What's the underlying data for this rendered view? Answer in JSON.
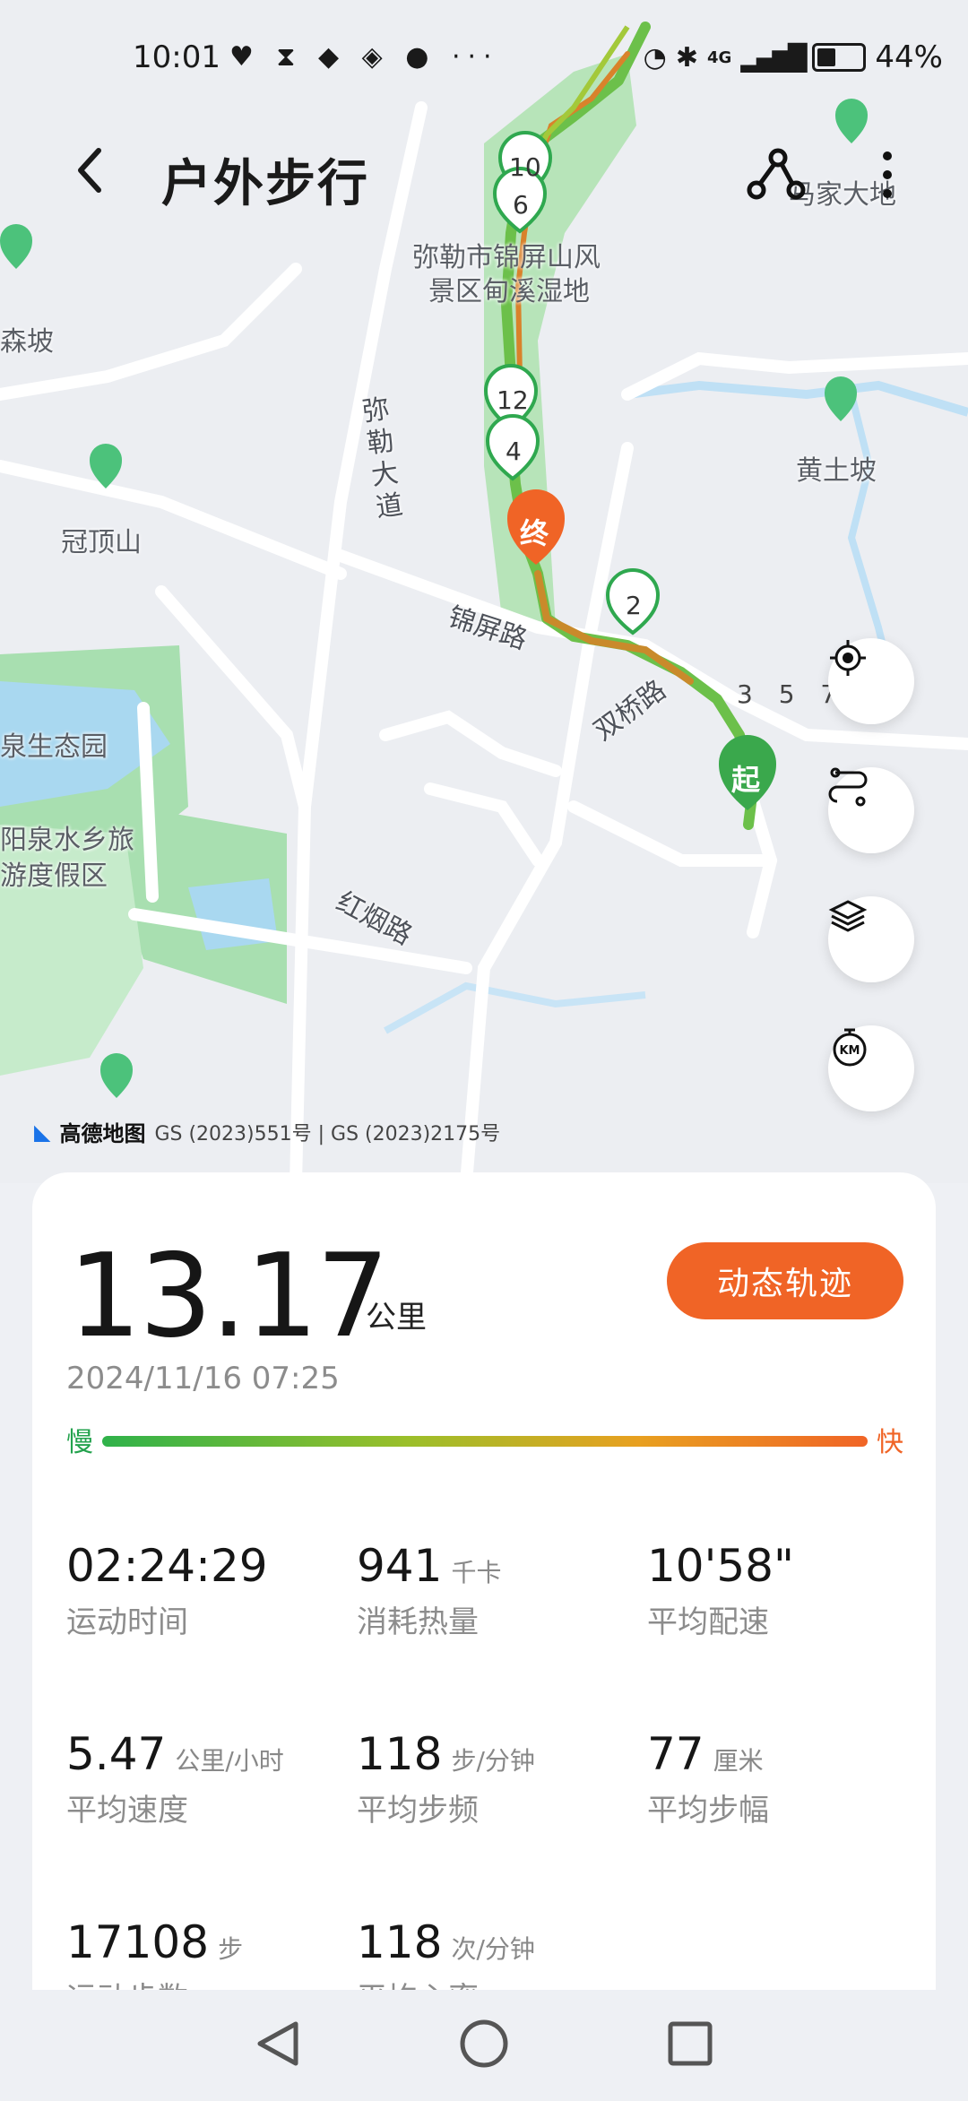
{
  "status": {
    "time": "10:01",
    "icons_left": "♥ ⧗ ◆ ◈ ● ···",
    "battery_percent": "44%",
    "signal": "4G"
  },
  "header": {
    "title": "户外步行"
  },
  "map": {
    "labels": {
      "mile": "弥勒市锦屏山风",
      "mile2": "景区甸溪湿地",
      "madadi": "马家大地",
      "senpo": "森坡",
      "huangtupo": "黄土坡",
      "guandingshan": "冠顶山",
      "quanshengtai": "泉生态园",
      "quanshui": "阳泉水乡旅",
      "quanshui2": "游度假区",
      "miledadao": "弥勒大道",
      "jinpinglu": "锦屏路",
      "shuangqiaolu": "双桥路",
      "hongyanlu": "红烟路"
    },
    "markers": [
      "10",
      "6",
      "12",
      "4",
      "2"
    ],
    "km_labels": "3 5 7",
    "start_label": "起",
    "end_label": "终",
    "attribution_logo": "高德地图",
    "attribution_text": "GS (2023)551号 | GS (2023)2175号"
  },
  "summary": {
    "distance": "13.17",
    "distance_unit": "公里",
    "dynamic_button": "动态轨迹",
    "date": "2024/11/16 07:25",
    "slow_label": "慢",
    "fast_label": "快"
  },
  "stats": [
    {
      "value": "02:24:29",
      "unit": "",
      "label": "运动时间"
    },
    {
      "value": "941",
      "unit": "千卡",
      "label": "消耗热量"
    },
    {
      "value": "10'58\"",
      "unit": "",
      "label": "平均配速"
    },
    {
      "value": "5.47",
      "unit": "公里/小时",
      "label": "平均速度"
    },
    {
      "value": "118",
      "unit": "步/分钟",
      "label": "平均步频"
    },
    {
      "value": "77",
      "unit": "厘米",
      "label": "平均步幅"
    },
    {
      "value": "17108",
      "unit": "步",
      "label": "运动步数"
    },
    {
      "value": "118",
      "unit": "次/分钟",
      "label": "平均心率"
    }
  ],
  "colors": {
    "accent": "#f06426",
    "slow": "#23a24d",
    "route_green": "#6cc04a"
  }
}
